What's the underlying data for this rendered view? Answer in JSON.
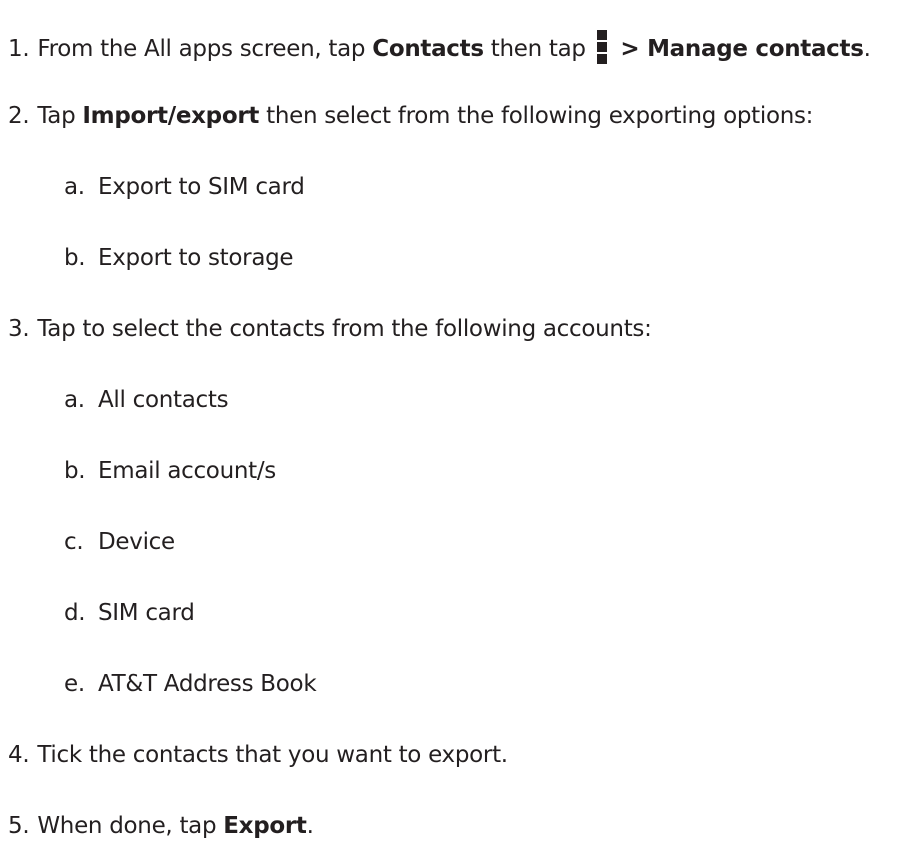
{
  "steps": [
    {
      "number": "1.",
      "pre": "From the All apps screen, tap ",
      "bold1": "Contacts",
      "mid": " then tap ",
      "icon": "overflow-menu-icon",
      "bold2": " > Manage contacts",
      "post": "."
    },
    {
      "number": "2.",
      "pre": "Tap ",
      "bold1": "Import/export",
      "post": " then select from the following exporting options:",
      "options": [
        {
          "letter": "a.",
          "text": "Export to SIM card"
        },
        {
          "letter": "b.",
          "text": "Export to storage"
        }
      ]
    },
    {
      "number": "3.",
      "text": "Tap to select the contacts from the following accounts:",
      "options": [
        {
          "letter": "a.",
          "text": "All contacts"
        },
        {
          "letter": "b.",
          "text": "Email account/s"
        },
        {
          "letter": "c.",
          "text": "Device"
        },
        {
          "letter": "d.",
          "text": "SIM card"
        },
        {
          "letter": "e.",
          "text": "AT&T Address Book"
        }
      ]
    },
    {
      "number": "4.",
      "text": "Tick the contacts that you want to export."
    },
    {
      "number": "5.",
      "pre": "When done, tap ",
      "bold1": "Export",
      "post": "."
    }
  ]
}
